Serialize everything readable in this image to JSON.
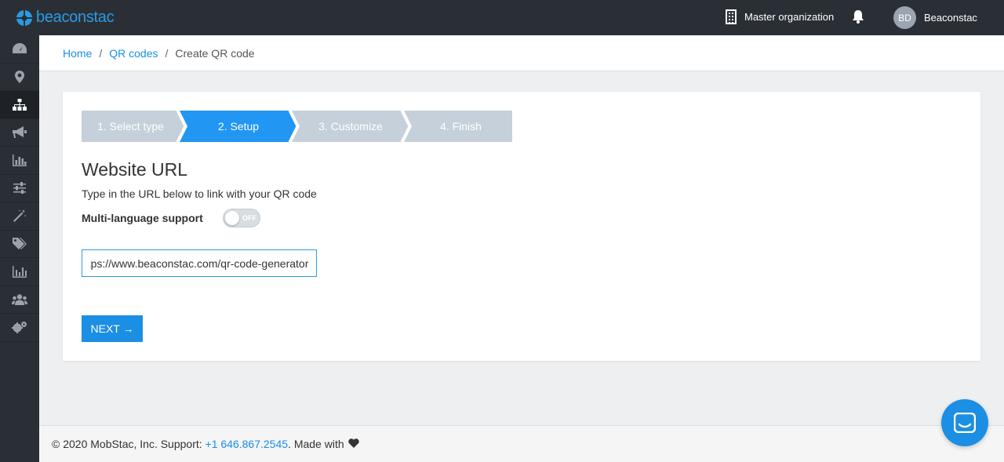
{
  "header": {
    "brand": "beaconstac",
    "organization": "Master organization",
    "user_initials": "BD",
    "user_name": "Beaconstac"
  },
  "sidebar": {
    "items": [
      {
        "icon": "dashboard-icon"
      },
      {
        "icon": "location-pin-icon"
      },
      {
        "icon": "sitemap-icon",
        "active": true
      },
      {
        "icon": "megaphone-icon"
      },
      {
        "icon": "bar-chart-icon"
      },
      {
        "icon": "sliders-icon"
      },
      {
        "icon": "magic-wand-icon"
      },
      {
        "icon": "tags-icon"
      },
      {
        "icon": "analytics-icon"
      },
      {
        "icon": "users-icon"
      },
      {
        "icon": "settings-icon"
      }
    ]
  },
  "breadcrumb": {
    "home": "Home",
    "qr_codes": "QR codes",
    "current": "Create QR code",
    "separator": "/"
  },
  "wizard": {
    "steps": [
      "1. Select type",
      "2. Setup",
      "3. Customize",
      "4. Finish"
    ],
    "active_step": 2,
    "colors": {
      "active": "#2196f3",
      "inactive": "#c5d0da"
    }
  },
  "form": {
    "title": "Website URL",
    "subtitle": "Type in the URL below to link with your QR code",
    "multilang_label": "Multi-language support",
    "toggle_state": "OFF",
    "url_value": "https://www.beaconstac.com/qr-code-generator",
    "next_label": "NEXT →"
  },
  "footer": {
    "copyright": "© 2020 MobStac, Inc. Support: ",
    "phone": "+1 646.867.2545",
    "made_with": ". Made with",
    "heart": "❤"
  },
  "accent_color": "#1a8fe3"
}
